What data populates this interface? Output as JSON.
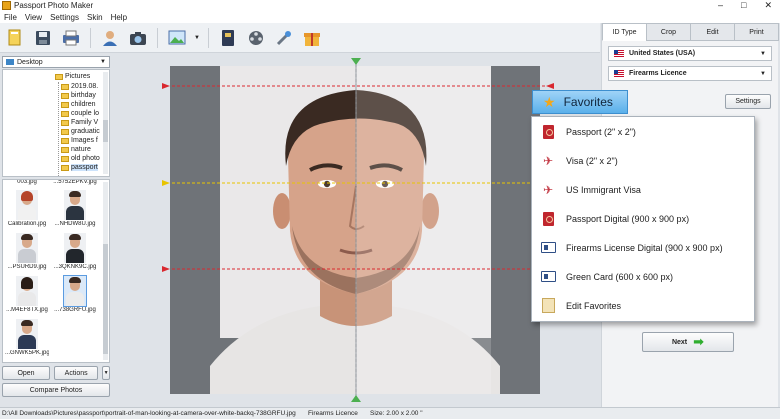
{
  "window": {
    "title": "Passport Photo Maker",
    "controls": [
      "–",
      "□",
      "✕"
    ]
  },
  "menu": [
    "File",
    "View",
    "Settings",
    "Skin",
    "Help"
  ],
  "toolbar": {
    "buttons": [
      "open-icon",
      "save-icon",
      "print-icon",
      "user-icon",
      "camera-icon",
      "image-icon",
      "book-icon",
      "film-icon",
      "tools-icon",
      "gift-icon"
    ]
  },
  "left": {
    "folder": "Desktop",
    "tree": [
      {
        "label": "Pictures"
      },
      {
        "label": "2019.08."
      },
      {
        "label": "birthday"
      },
      {
        "label": "children"
      },
      {
        "label": "couple lo"
      },
      {
        "label": "Family V"
      },
      {
        "label": "graduatic"
      },
      {
        "label": "Images f"
      },
      {
        "label": "nature"
      },
      {
        "label": "old photo"
      },
      {
        "label": "passport"
      }
    ],
    "thumbs": [
      {
        "caption": "003.jpg"
      },
      {
        "caption": "...5752EPKV.jpg"
      },
      {
        "caption": "Calibration.jpg"
      },
      {
        "caption": "...NHDW8U.jpg"
      },
      {
        "caption": "...PSURD9.jpg"
      },
      {
        "caption": "...3QKNK9C.jpg"
      },
      {
        "caption": "...M4EF8TX.jpg"
      },
      {
        "caption": "...738GRFU.jpg"
      },
      {
        "caption": "...GNWK5PK.jpg"
      }
    ],
    "open_label": "Open",
    "actions_label": "Actions",
    "compare_label": "Compare Photos"
  },
  "right": {
    "tabs": [
      "ID Type",
      "Crop",
      "Edit",
      "Print"
    ],
    "country": "United States (USA)",
    "document": "Firearms Licence",
    "settings_label": "Settings",
    "next_label": "Next"
  },
  "favorites": {
    "header": "Favorites",
    "items": [
      {
        "label": "Passport (2\" x 2\")",
        "icon": "passport-icon"
      },
      {
        "label": "Visa  (2\" x 2\")",
        "icon": "plane-icon"
      },
      {
        "label": "US Immigrant Visa",
        "icon": "plane-icon"
      },
      {
        "label": "Passport Digital (900 x 900 px)",
        "icon": "passport-icon"
      },
      {
        "label": "Firearms License Digital (900 x 900 px)",
        "icon": "id-card-icon"
      },
      {
        "label": "Green Card (600 x 600 px)",
        "icon": "id-card-icon"
      },
      {
        "label": "Edit Favorites",
        "icon": "edit-icon"
      }
    ]
  },
  "status": {
    "path": "D:\\All Downloads\\Pictures\\passport\\portrait-of-man-looking-at-camera-over-white-backq-738GRFU.jpg",
    "doc": "Firearms Licence",
    "size": "Size: 2.00 x 2.00 \""
  },
  "colors": {
    "accent": "#5ab0ea",
    "crop_line": "#d9282f",
    "guide_yellow": "#e8c400",
    "next_arrow": "#2fae2f"
  }
}
